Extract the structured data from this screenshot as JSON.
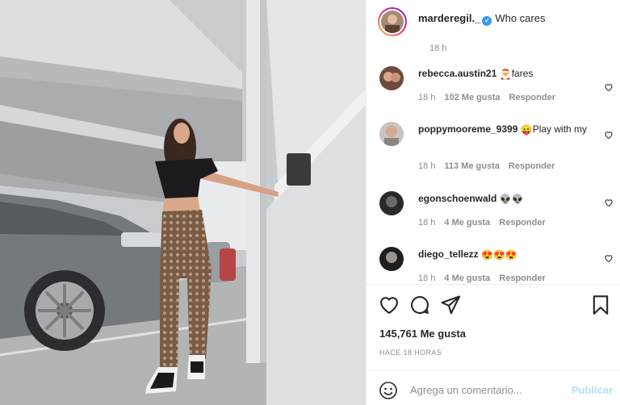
{
  "post": {
    "author": "marderegil._",
    "verified_icon": "verified-badge-icon",
    "caption": "Who cares",
    "caption_time": "18 h",
    "likes": "145,761 Me gusta",
    "posted": "HACE 18 HORAS"
  },
  "comments": [
    {
      "username": "rebecca.austin21",
      "emoji": "🎅",
      "text": "fares",
      "time": "18 h",
      "likes": "102 Me gusta",
      "reply": "Responder"
    },
    {
      "username": "poppymooreme_9399",
      "emoji": "😛",
      "text": "Play with my",
      "time": "18 h",
      "likes": "113 Me gusta",
      "reply": "Responder"
    },
    {
      "username": "egonschoenwald",
      "emoji": "👽👽",
      "text": "",
      "time": "18 h",
      "likes": "4 Me gusta",
      "reply": "Responder"
    },
    {
      "username": "diego_tellezz",
      "emoji": "😍😍😍",
      "text": "",
      "time": "18 h",
      "likes": "4 Me gusta",
      "reply": "Responder"
    }
  ],
  "composer": {
    "placeholder": "Agrega un comentario...",
    "publish_label": "Publicar"
  },
  "icons": {
    "like": "heart-icon",
    "comment": "comment-icon",
    "share": "share-icon",
    "save": "bookmark-icon",
    "emoji": "emoji-icon"
  },
  "colors": {
    "link_blue": "#3897f0",
    "publish_disabled": "#b2dffc",
    "muted_text": "#8e8e8e"
  }
}
